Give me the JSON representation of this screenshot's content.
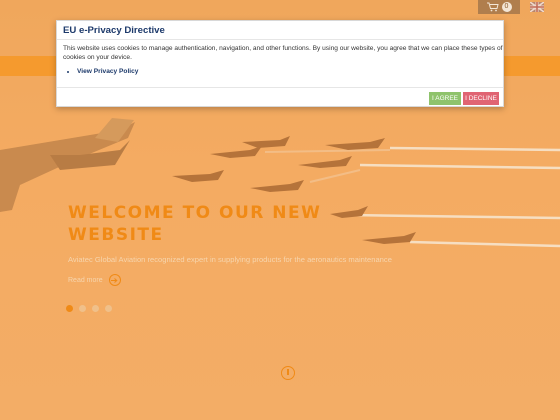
{
  "topbar": {
    "cart_count": "0"
  },
  "icons": {
    "cart": "cart-icon",
    "flag": "uk-flag-icon",
    "read_more": "arrow-circle-icon",
    "scroll": "scroll-down-icon"
  },
  "hero": {
    "title_line1": "WELCOME TO OUR NEW",
    "title_line2": "WEBSITE",
    "subtitle": "Aviatec Global Aviation recognized expert in supplying products for the aeronautics maintenance",
    "read_more": "Read more",
    "slides": 4,
    "active_slide": 1
  },
  "modal": {
    "title": "EU e-Privacy Directive",
    "text": "This website uses cookies to manage authentication, navigation, and other functions. By using our website, you agree that we can place these types of cookies on your device.",
    "policy_link": "View Privacy Policy",
    "agree_label": "I AGREE",
    "decline_label": "I DECLINE"
  },
  "colors": {
    "accent": "#f08a16",
    "agree": "#8fc36c",
    "decline": "#e06473",
    "title": "#1d3a6b"
  }
}
